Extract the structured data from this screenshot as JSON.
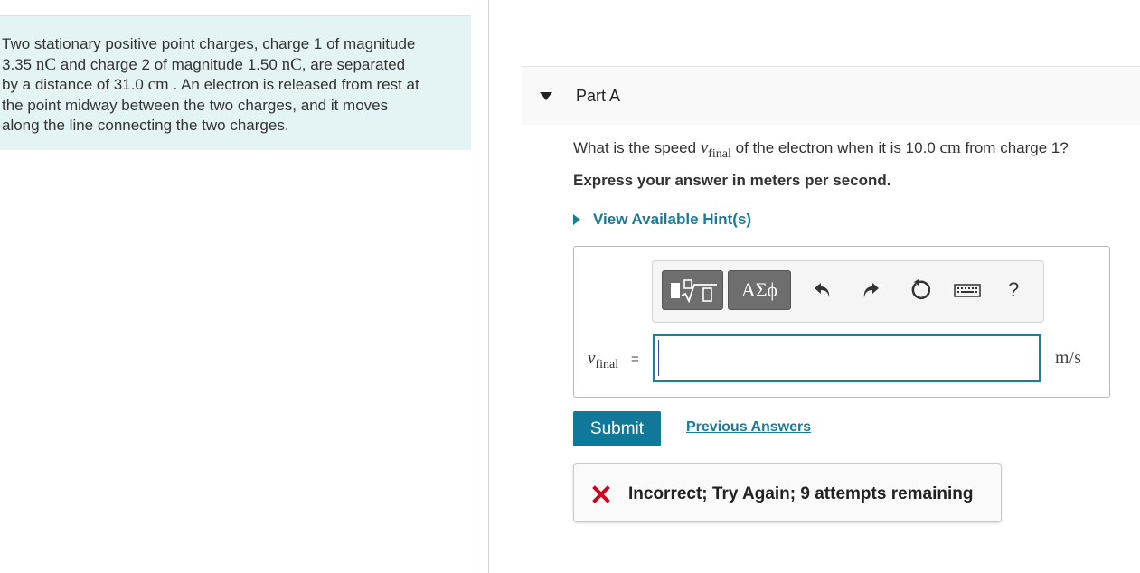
{
  "problem": {
    "seg1": "Two stationary positive point charges, charge 1 of magnitude",
    "q1_value": "3.35",
    "q1_unit": "nC",
    "seg2": "and charge 2 of magnitude 1.50",
    "q2_unit": "nC",
    "seg3": ", are separated",
    "seg4": "by a distance of 31.0",
    "d_unit": "cm",
    "seg5": ". An electron is released from rest at",
    "seg6": "the point midway between the two charges, and it moves",
    "seg7": "along the line connecting the two charges."
  },
  "part": {
    "title": "Part A"
  },
  "question": {
    "pre": "What is the speed",
    "var": "v",
    "var_sub": "final",
    "mid": "of the electron when it is 10.0",
    "unit": "cm",
    "post": "from charge 1?"
  },
  "instruction": "Express your answer in meters per second.",
  "hints_label": "View Available Hint(s)",
  "toolbar": {
    "greek_label": "ΑΣϕ",
    "help_label": "?"
  },
  "answer": {
    "var": "v",
    "var_sub": "final",
    "equals": "=",
    "value": "",
    "unit": "m/s"
  },
  "submit_label": "Submit",
  "previous_answers_label": "Previous Answers",
  "feedback": {
    "text": "Incorrect; Try Again; 9 attempts remaining",
    "color": "#d0021b"
  },
  "colors": {
    "accent": "#12789a",
    "link": "#1a7a9a",
    "problem_bg": "#e4f4f5"
  }
}
